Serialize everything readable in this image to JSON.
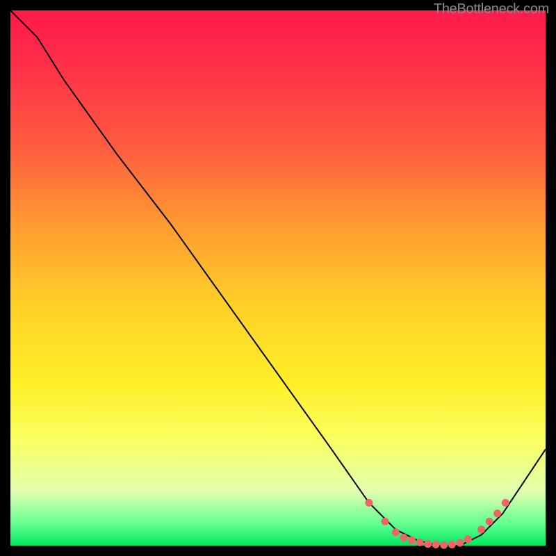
{
  "watermark": "TheBottleneck.com",
  "chart_data": {
    "type": "line",
    "title": "",
    "xlabel": "",
    "ylabel": "",
    "xlim": [
      0,
      100
    ],
    "ylim": [
      0,
      100
    ],
    "colors": {
      "curve": "#000000",
      "dots": "#ef6464"
    },
    "gradient_stops": [
      {
        "pos": 0,
        "color": "#ff1a4a"
      },
      {
        "pos": 50,
        "color": "#ffd028"
      },
      {
        "pos": 95,
        "color": "#e0ffb0"
      },
      {
        "pos": 100,
        "color": "#00e860"
      }
    ],
    "x": [
      0,
      3,
      5,
      10,
      20,
      30,
      40,
      50,
      60,
      67,
      72,
      76,
      80,
      84,
      88,
      92,
      100
    ],
    "values": [
      100,
      97,
      95,
      87,
      73,
      60,
      46,
      32,
      18,
      8,
      3,
      1,
      0,
      0,
      2,
      6,
      18
    ],
    "dot_points": [
      {
        "x": 67,
        "y": 8
      },
      {
        "x": 70,
        "y": 4.5
      },
      {
        "x": 72,
        "y": 2.5
      },
      {
        "x": 73.5,
        "y": 1.5
      },
      {
        "x": 75,
        "y": 1
      },
      {
        "x": 76.5,
        "y": 0.6
      },
      {
        "x": 78,
        "y": 0.3
      },
      {
        "x": 79.5,
        "y": 0.2
      },
      {
        "x": 81,
        "y": 0.1
      },
      {
        "x": 82.5,
        "y": 0.2
      },
      {
        "x": 84,
        "y": 0.5
      },
      {
        "x": 85.5,
        "y": 1.2
      },
      {
        "x": 88,
        "y": 3
      },
      {
        "x": 89.5,
        "y": 4.5
      },
      {
        "x": 91,
        "y": 6
      },
      {
        "x": 92.5,
        "y": 8
      }
    ]
  }
}
